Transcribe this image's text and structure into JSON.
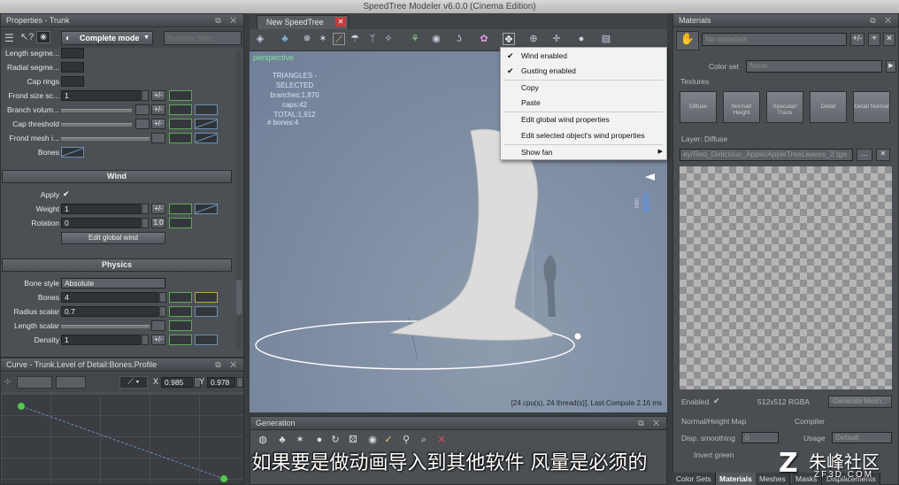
{
  "window": {
    "title": "SpeedTree Modeler v6.0.0 (Cinema Edition)"
  },
  "properties": {
    "header": "Properties - Trunk",
    "mode": "Complete mode",
    "filter_placeholder": "Property filter",
    "rows": [
      {
        "label": "Length segme...",
        "value": ""
      },
      {
        "label": "Radial segme...",
        "value": ""
      },
      {
        "label": "Cap rings",
        "value": ""
      },
      {
        "label": "Frond size sc...",
        "value": "1"
      },
      {
        "label": "Branch volum...",
        "value": ""
      },
      {
        "label": "Cap threshold",
        "value": ""
      },
      {
        "label": "Frond mesh i...",
        "value": ""
      },
      {
        "label": "Bones",
        "value": ""
      }
    ],
    "wind": {
      "title": "Wind",
      "apply_label": "Apply",
      "apply_checked": true,
      "weight_label": "Weight",
      "weight_value": "1",
      "rotation_label": "Rotation",
      "rotation_value": "0",
      "rotation_btn": "1.0",
      "edit_button": "Edit global wind",
      "plusminus": "+/-"
    },
    "physics": {
      "title": "Physics",
      "bone_style_label": "Bone style",
      "bone_style_value": "Absolute",
      "bones_label": "Bones",
      "bones_value": "4",
      "radius_label": "Radius scalar",
      "radius_value": "0.7",
      "length_label": "Length scalar",
      "density_label": "Density",
      "density_value": "1"
    }
  },
  "curve": {
    "header": "Curve - Trunk.Level of Detail:Bones.Profile",
    "x_label": "X",
    "x_value": "0.985",
    "y_label": "Y",
    "y_value": "0.978"
  },
  "viewport": {
    "tab": "New SpeedTree",
    "label": "perspective",
    "stats_title": "TRIANGLES - SELECTED",
    "stats": [
      "branches:1,870",
      "caps:42",
      "TOTAL:1,912"
    ],
    "bones": "# bones:4",
    "status": "[24 cpu(s), 24 thread(s)], Last Compute 2.16 ms",
    "min_label": "Min"
  },
  "context_menu": {
    "items": [
      {
        "label": "Wind enabled",
        "checked": true
      },
      {
        "label": "Gusting enabled",
        "checked": true
      },
      {
        "label": "Copy",
        "checked": false
      },
      {
        "label": "Paste",
        "checked": false
      },
      {
        "label": "Edit global wind properties",
        "checked": false
      },
      {
        "label": "Edit selected object's wind properties",
        "checked": false
      },
      {
        "label": "Show fan",
        "checked": false
      }
    ]
  },
  "generation": {
    "header": "Generation"
  },
  "materials": {
    "header": "Materials",
    "material_select": "No materials",
    "color_set_label": "Color set",
    "color_set_value": "None",
    "textures_label": "Textures",
    "texture_buttons": [
      "Diffuse",
      "Normal/ Height",
      "Specular/ Trans",
      "Detail",
      "Detail Normal"
    ],
    "layer_label": "Layer: Diffuse",
    "layer_path": "ey/Red_Delicious_Apple/AppleTreeLeaves_2.tga",
    "enabled_label": "Enabled",
    "tex_info": "512x512  RGBA",
    "generate_btn": "Generate Mesh...",
    "nhm_label": "Normal/Height Map",
    "disp_label": "Disp. smoothing",
    "disp_value": "0",
    "invert_label": "Invert green",
    "compiler_label": "Compiler",
    "usage_label": "Usage",
    "usage_value": "Default",
    "tabs": [
      "Color Sets",
      "Materials",
      "Meshes",
      "Masks",
      "Displacements"
    ]
  },
  "subtitle": "如果要是做动画导入到其他软件 风量是必须的",
  "watermark": {
    "brand": "朱峰社区",
    "url": "ZF3D.COM"
  }
}
